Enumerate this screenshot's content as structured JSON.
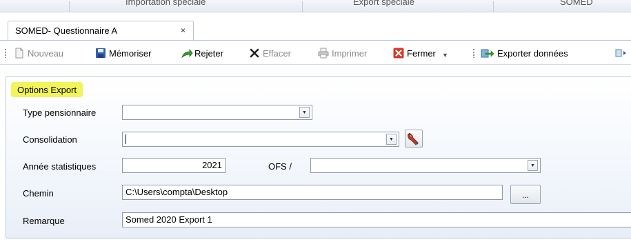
{
  "top_strip": {
    "items": [
      "Importation spéciale",
      "Export spéciale",
      "SOMED"
    ]
  },
  "tab": {
    "label": "SOMED- Questionnaire A",
    "close": "×"
  },
  "toolbar": {
    "nouveau": "Nouveau",
    "memoriser": "Mémoriser",
    "rejeter": "Rejeter",
    "effacer": "Effacer",
    "imprimer": "Imprimer",
    "fermer": "Fermer",
    "exporter": "Exporter données"
  },
  "icons": {
    "nouveau": "new-document-icon",
    "memoriser": "save-disk-icon",
    "rejeter": "reject-arrow-icon",
    "effacer": "delete-x-icon",
    "imprimer": "printer-icon",
    "fermer": "close-red-icon",
    "exporter": "export-data-icon",
    "more": "arrow-right-icon"
  },
  "colors": {
    "legend_highlight": "#f1f45a",
    "save_blue": "#2e5fb5",
    "close_red": "#d6392b",
    "accent_green": "#3c9b2e"
  },
  "options_export": {
    "legend": "Options Export",
    "type_pensionnaire": {
      "label": "Type pensionnaire",
      "value": ""
    },
    "consolidation": {
      "label": "Consolidation",
      "value": ""
    },
    "annee": {
      "label": "Année statistiques",
      "value": "2021"
    },
    "ofs": {
      "label": "OFS /",
      "value": ""
    },
    "chemin": {
      "label": "Chemin",
      "value": "C:\\Users\\compta\\Desktop",
      "browse": "..."
    },
    "remarque": {
      "label": "Remarque",
      "value": "Somed 2020 Export 1"
    }
  }
}
